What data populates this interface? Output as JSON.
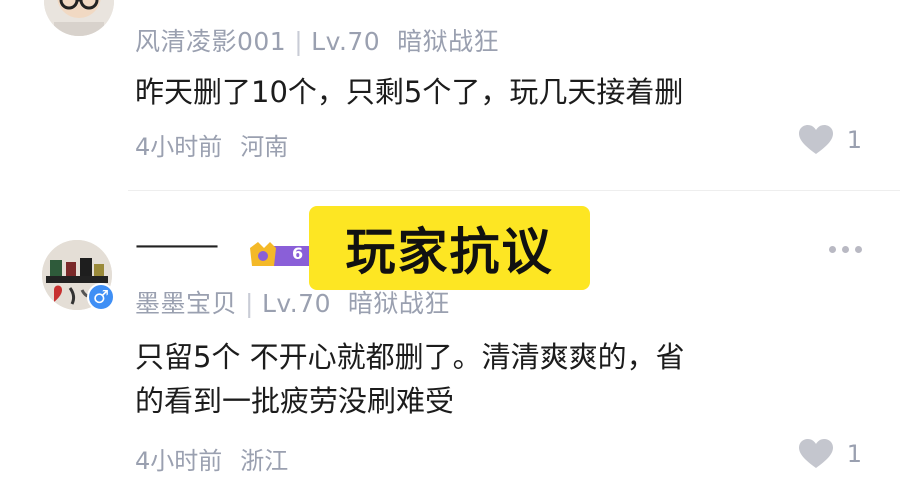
{
  "comments": [
    {
      "meta": {
        "username": "风清凌影001",
        "level": "Lv.70",
        "title": "暗狱战狂"
      },
      "text": "昨天删了10个，只剩5个了，玩几天接着删",
      "time": "4小时前",
      "location": "河南",
      "likes": "1"
    },
    {
      "display_name": "———",
      "badge_text": "6",
      "gender": "♂",
      "meta": {
        "username": "墨墨宝贝",
        "level": "Lv.70",
        "title": "暗狱战狂"
      },
      "text_line1": "只留5个  不开心就都删了。清清爽爽的，省",
      "text_line2": "的看到一批疲劳没刷难受",
      "time": "4小时前",
      "location": "浙江",
      "likes": "1"
    }
  ],
  "overlay": {
    "caption": "玩家抗议"
  },
  "colors": {
    "banner": "#fde623",
    "meta": "#9aa0b0",
    "gender_badge": "#3f8ff5"
  }
}
